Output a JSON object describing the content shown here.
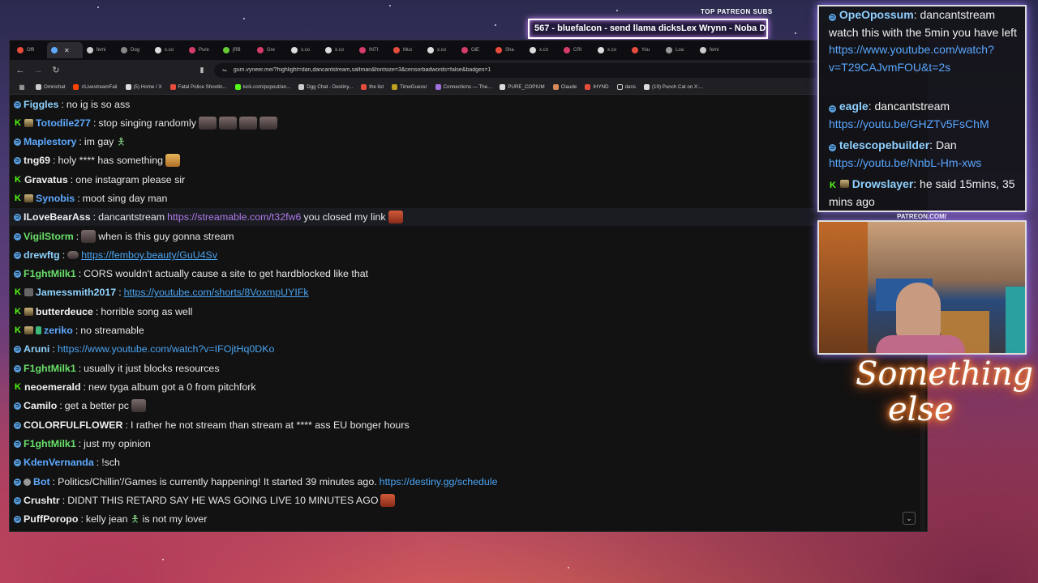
{
  "overlay": {
    "patreon_label": "TOP PATREON SUBS",
    "ticker": "567 - bluefalcon - send llama dicksLex Wrynn -  Noba D",
    "webcam_label": "PATREON.COM/",
    "neon_line1": "Something",
    "neon_line2": "else"
  },
  "browser": {
    "tabs": [
      "Offi",
      "",
      "femi",
      "Dog",
      "x.co",
      "Pure",
      "jRB",
      "Gre",
      "x.co",
      "x.co",
      "INTI",
      "Mus",
      "x.co",
      "OiE",
      "Sha",
      "x.co",
      "CRI",
      "x.co",
      "You",
      "Loa",
      "femi"
    ],
    "url": "gum.vyneer.me/?highlight=dan,dancantstream,saltman&fontsize=3&censorbadwords=false&badges=1",
    "bookmarks": [
      "Omnichat",
      "r/LivestreamFail",
      "(5) Home / X",
      "Fatal Police Shootin...",
      "kick.com/popout/an...",
      "Dgg Chat - Destiny...",
      "the list",
      "TimeGuessr",
      "Connections — The...",
      "PURE_COPIUM",
      "Claude",
      "IHYND",
      "dans",
      "(19) Punch Cat on X:..."
    ]
  },
  "chat": {
    "messages": [
      {
        "user": "Figgles",
        "text": "no ig is so ass"
      },
      {
        "user": "Totodile277",
        "text": "stop singing randomly"
      },
      {
        "user": "Maplestory",
        "text": "im gay"
      },
      {
        "user": "tng69",
        "text": "holy **** has something"
      },
      {
        "user": "Gravatus",
        "text": "one instagram please sir"
      },
      {
        "user": "Synobis",
        "text": "moot sing day man"
      },
      {
        "user": "ILoveBearAss",
        "text": "dancantstream",
        "link": "https://streamable.com/t32fw6",
        "after": "you closed my link"
      },
      {
        "user": "VigilStorm",
        "text": "when is this guy gonna stream"
      },
      {
        "user": "drewftg",
        "link": "https://femboy.beauty/GuU4Sv"
      },
      {
        "user": "F1ghtMilk1",
        "text": "CORS wouldn't actually cause a site to get hardblocked like that"
      },
      {
        "user": "Jamessmith2017",
        "link": "https://youtube.com/shorts/8VoxmpUYIFk"
      },
      {
        "user": "butterdeuce",
        "text": "horrible song as well"
      },
      {
        "user": "zeriko",
        "text": "no streamable"
      },
      {
        "user": "Aruni",
        "link": "https://www.youtube.com/watch?v=IFOjtHq0DKo"
      },
      {
        "user": "F1ghtMilk1",
        "text": "usually it just blocks resources"
      },
      {
        "user": "neoemerald",
        "text": "new tyga album got a 0 from pitchfork"
      },
      {
        "user": "Camilo",
        "text": "get a better pc"
      },
      {
        "user": "COLORFULFLOWER",
        "text": "I rather he not stream than stream at **** ass EU bonger hours"
      },
      {
        "user": "F1ghtMilk1",
        "text": "just my opinion"
      },
      {
        "user": "KdenVernanda",
        "text": "!sch"
      },
      {
        "user": "Bot",
        "text": "Politics/Chillin'/Games is currently happening! It started 39 minutes ago.",
        "link": "https://destiny.gg/schedule"
      },
      {
        "user": "Crushtr",
        "text": "DIDNT THIS RETARD SAY HE WAS GOING LIVE 10 MINUTES AGO"
      },
      {
        "user": "PuffPoropo",
        "text": "kelly jean",
        "after": "is not my lover"
      }
    ]
  },
  "side_chat": {
    "m0": {
      "user": "OpeOpossum",
      "text": "dancantstream watch this with the 5min you have left",
      "link": "https://www.youtube.com/watch?v=T29CAJvmFOU&t=2s"
    },
    "m1": {
      "user": "eagle",
      "text": "dancantstream",
      "link": "https://youtu.be/GHZTv5FsChM"
    },
    "m2": {
      "user": "telescopebuilder",
      "text": "Dan",
      "link": "https://youtu.be/NnbL-Hm-xws"
    },
    "m3": {
      "user": "Drowslayer",
      "text": "he said 15mins, 35 mins ago"
    }
  },
  "colors": {
    "accent": "#5ea9ff",
    "kick_green": "#53fc18",
    "neon_glow": "#ff7a2a"
  }
}
